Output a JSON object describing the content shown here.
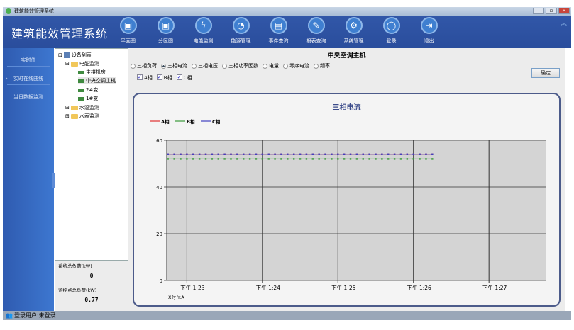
{
  "window": {
    "title": "建筑能效管理系统"
  },
  "header": {
    "brand": "建筑能效管理系统",
    "nav": [
      {
        "label": "平面图",
        "icon": "monitor-icon"
      },
      {
        "label": "分区图",
        "icon": "monitor-icon"
      },
      {
        "label": "电能监测",
        "icon": "lightning-icon"
      },
      {
        "label": "能源管理",
        "icon": "gauge-icon"
      },
      {
        "label": "事件查询",
        "icon": "event-icon"
      },
      {
        "label": "报表查询",
        "icon": "report-icon"
      },
      {
        "label": "系统管理",
        "icon": "gear-icon"
      },
      {
        "label": "登录",
        "icon": "user-icon"
      },
      {
        "label": "退出",
        "icon": "exit-icon"
      }
    ]
  },
  "sidebar": {
    "items": [
      {
        "label": "实时值"
      },
      {
        "label": "实时在线曲线",
        "active": true
      },
      {
        "label": "当日数据监测"
      }
    ]
  },
  "tree": {
    "root": "设备列表",
    "groups": [
      {
        "label": "电能监测",
        "children": [
          "主楼机房",
          "中央空调主机",
          "2#变",
          "1#变"
        ]
      },
      {
        "label": "水温监测"
      },
      {
        "label": "水表监测"
      }
    ],
    "selected": "中央空调主机"
  },
  "stats": {
    "system_load_label": "系统总负荷(kW)",
    "system_load": "0",
    "monitor_load_label": "监控点总负荷(kW)",
    "monitor_load": "0.77"
  },
  "main": {
    "device_title": "中央空调主机",
    "radios": [
      "三相负荷",
      "三相电流",
      "三相电压",
      "三相功率因数",
      "电量",
      "零序电流",
      "频率"
    ],
    "radio_selected": 1,
    "checks": [
      "A相",
      "B相",
      "C相"
    ],
    "ok_label": "确定"
  },
  "chart_data": {
    "type": "line",
    "title": "三相电流",
    "xlabel": "X时 Y:A",
    "ylim": [
      0,
      60
    ],
    "yticks": [
      0,
      20,
      40,
      60
    ],
    "xlim": [
      "13:22:44",
      "13:27:45"
    ],
    "xticks": [
      "13:23",
      "13:24",
      "13:25",
      "13:26",
      "13:27"
    ],
    "xtick_labels": [
      "下午 1:23",
      "下午 1:24",
      "下午 1:25",
      "下午 1:26",
      "下午 1:27"
    ],
    "x_range": [
      "13:22:45",
      "13:26:15"
    ],
    "x_step_seconds": 5,
    "series": [
      {
        "name": "A相",
        "color": "#e03030",
        "value": 54
      },
      {
        "name": "B相",
        "color": "#3a9a3a",
        "value": 52
      },
      {
        "name": "C相",
        "color": "#4040c0",
        "value": 54
      }
    ],
    "legend": "top-left",
    "plot_bg": "#d4d4d4",
    "grid": true
  },
  "status": {
    "text": "登录用户:未登录"
  }
}
